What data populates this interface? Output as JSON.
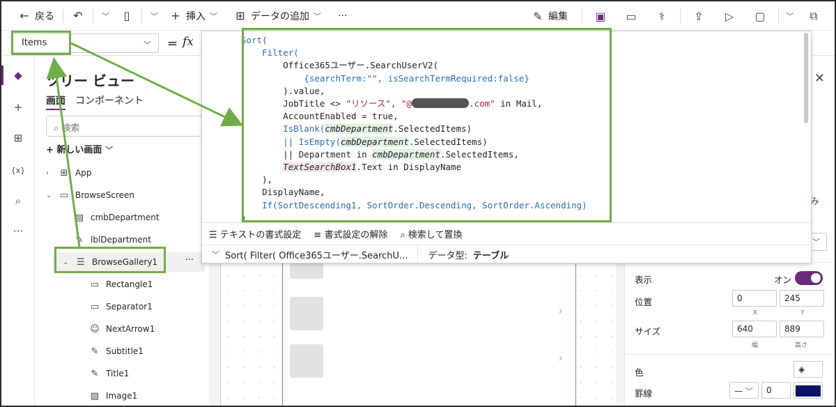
{
  "commandbar": {
    "back": "戻る",
    "insert": "挿入",
    "add_data": "データの追加",
    "more": "···",
    "edit": "編集"
  },
  "formula_bar": {
    "property": "Items",
    "equals": "=",
    "fx": "fx"
  },
  "formula_code": {
    "l1": "Sort(",
    "l2": "    Filter(",
    "l3": "        Office365ユーザー.SearchUserV2(",
    "l4": "            {searchTerm:\"\", isSearchTermRequired:false}",
    "l5": "        ).value,",
    "l6a": "        JobTitle <> ",
    "l6s": "\"リソース\"",
    "l6b": ", ",
    "l6c": "\"@",
    "l6d": ".com\"",
    "l6e": " in Mail,",
    "l7": "        AccountEnabled = true,",
    "l8a": "        IsBlank(",
    "l8b": "cmbDepartment",
    "l8c": ".SelectedItems)",
    "l9a": "        || IsEmpty(",
    "l9b": "cmbDepartment",
    "l9c": ".SelectedItems)",
    "l10a": "        || Department in ",
    "l10b": "cmbDepartment",
    "l10c": ".SelectedItems,",
    "l11a": "        ",
    "l11b": "TextSearchBox1",
    "l11c": ".Text in DisplayName",
    "l12": "    ),",
    "l13": "    DisplayName,",
    "l14": "    If(SortDescending1, SortOrder.Descending, SortOrder.Ascending)",
    "l15": ")"
  },
  "editor_tools": {
    "format_text": "テキストの書式設定",
    "remove_format": "書式設定の解除",
    "find_replace": "検索して置換"
  },
  "editor_status": {
    "formula_preview": "Sort( Filter( Office365ユーザー.SearchU...",
    "data_type_label": "データ型:",
    "data_type_value": "テーブル"
  },
  "tree": {
    "title": "ツリー ビュー",
    "tab_screens": "画面",
    "tab_components": "コンポーネント",
    "search_placeholder": "検索",
    "new_screen": "新しい画面",
    "nodes": [
      "App",
      "BrowseScreen",
      "cmbDepartment",
      "lblDepartment",
      "BrowseGallery1",
      "Rectangle1",
      "Separator1",
      "NextArrow1",
      "Subtitle1",
      "Title1",
      "Image1"
    ],
    "more": "···"
  },
  "properties": {
    "partial": "み",
    "visible_label": "表示",
    "visible_value": "オン",
    "position_label": "位置",
    "x_value": "0",
    "y_value": "245",
    "x_sub": "X",
    "y_sub": "Y",
    "size_label": "サイズ",
    "width_value": "640",
    "height_value": "889",
    "width_sub": "幅",
    "height_sub": "高さ",
    "color_label": "色",
    "border_label": "罫線",
    "border_width": "0",
    "border_color": "#0f1268"
  },
  "accent_color": "#6b2a7a",
  "annotation_color": "#70ad47"
}
